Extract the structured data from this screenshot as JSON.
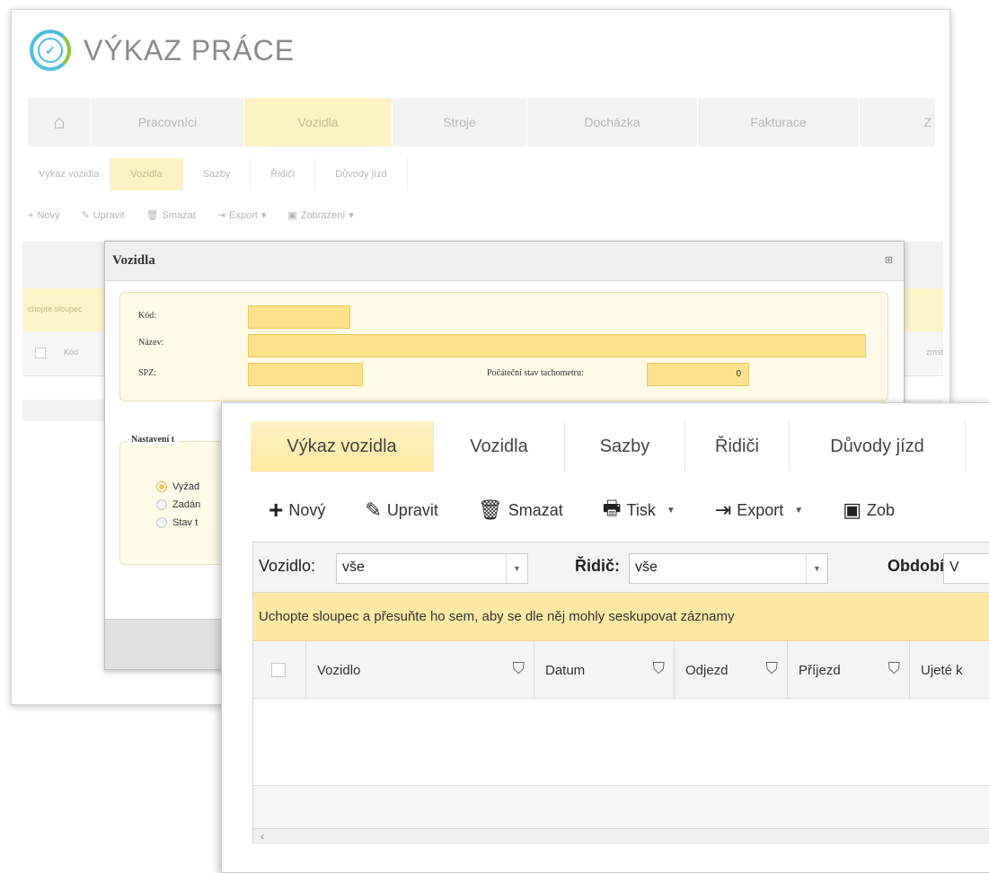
{
  "back": {
    "app_title": "VÝKAZ PRÁCE",
    "nav": [
      "Pracovníci",
      "Vozidla",
      "Stroje",
      "Docházka",
      "Fakturace",
      "Z"
    ],
    "subnav": [
      "Výkaz vozidla",
      "Vozidla",
      "Sazby",
      "Řidiči",
      "Důvody jízd"
    ],
    "toolbar": [
      "Nový",
      "Upravit",
      "Smazat",
      "Export",
      "Zobrazení"
    ],
    "group_hint": "chopte sloupec",
    "col_kod": "Kód",
    "col_right": "zmst"
  },
  "dialog": {
    "title": "Vozidla",
    "labels": {
      "kod": "Kód:",
      "nazev": "Název:",
      "spz": "SPZ:",
      "tacho": "Počáteční stav tachometru:"
    },
    "tacho_value": "0",
    "settings_legend": "Nastavení t",
    "options": [
      "Vyžad",
      "Zadán",
      "Stav t"
    ]
  },
  "front": {
    "tabs": [
      "Výkaz vozidla",
      "Vozidla",
      "Sazby",
      "Řidiči",
      "Důvody jízd"
    ],
    "toolbar": {
      "new": "Nový",
      "edit": "Upravit",
      "delete": "Smazat",
      "print": "Tisk",
      "export": "Export",
      "view": "Zob"
    },
    "filters": {
      "vehicle_label": "Vozidlo:",
      "vehicle_value": "vše",
      "driver_label": "Řidič:",
      "driver_value": "vše",
      "period_label": "Období:",
      "period_value": "V"
    },
    "group_bar": "Uchopte sloupec a přesuňte ho sem, aby se dle něj mohly seskupovat záznamy",
    "columns": [
      "Vozidlo",
      "Datum",
      "Odjezd",
      "Příjezd",
      "Ujeté k"
    ],
    "scroll_left": "‹"
  }
}
